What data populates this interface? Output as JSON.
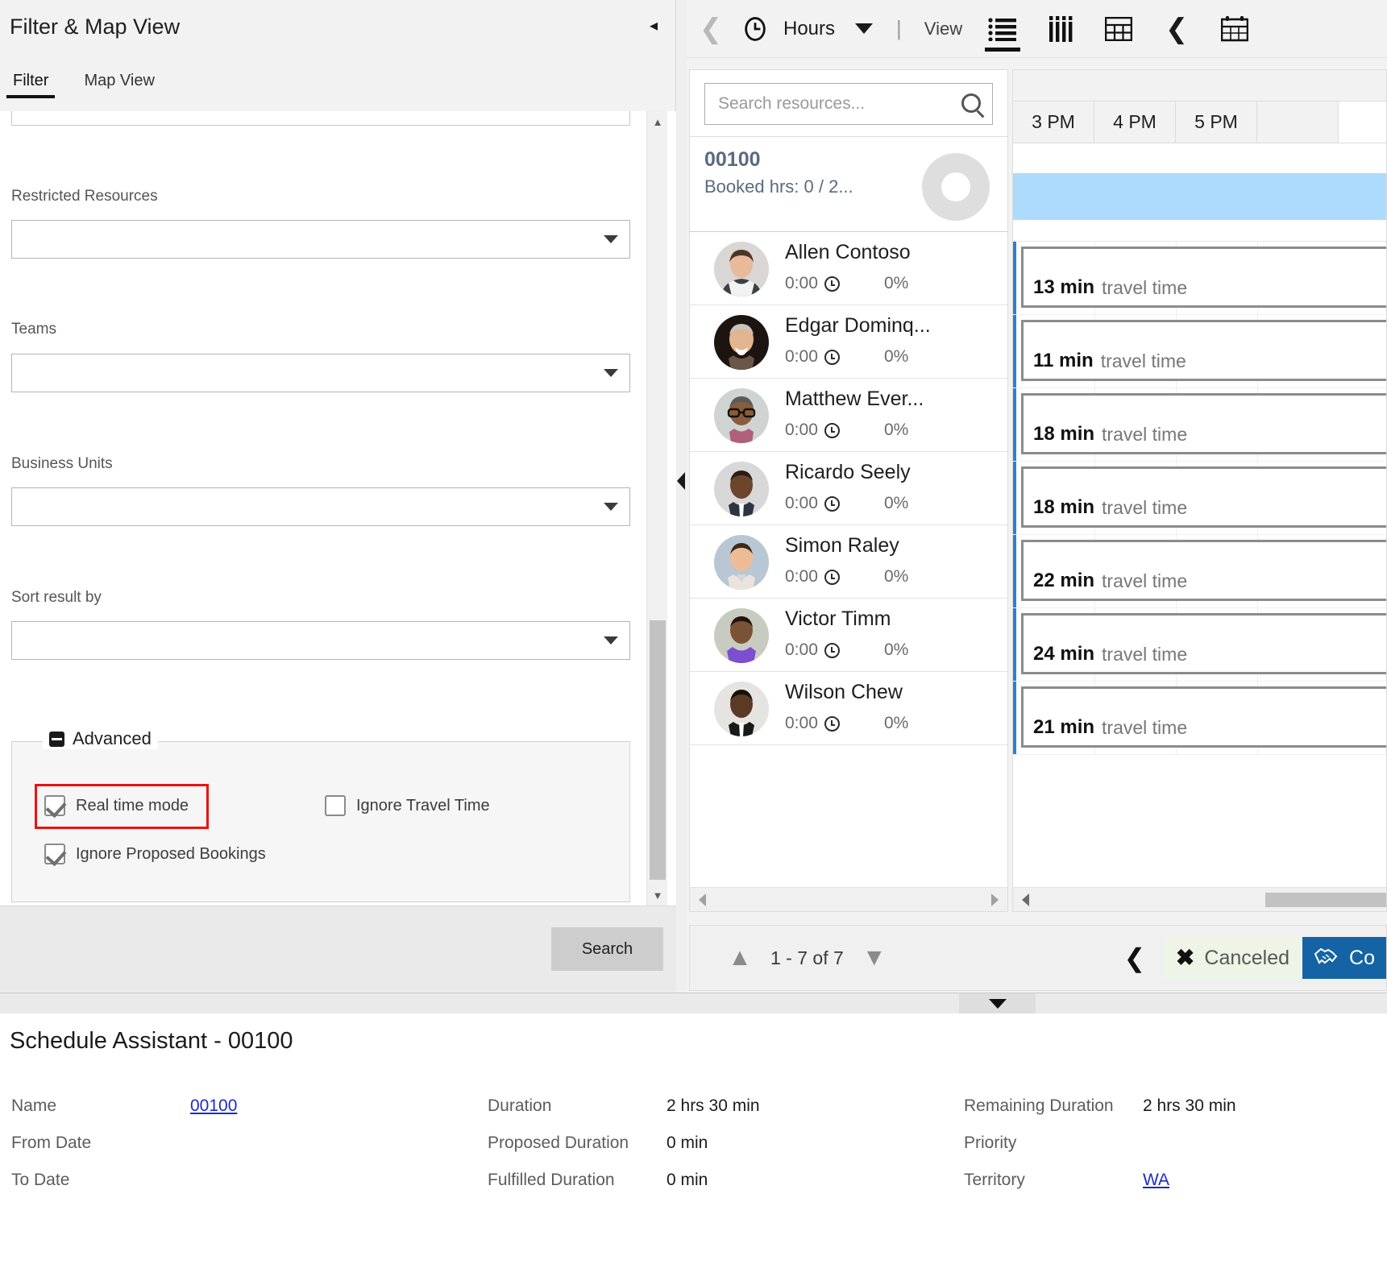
{
  "filter_panel": {
    "title": "Filter & Map View",
    "collapse_icon": "chevron-left-icon",
    "tabs": [
      {
        "label": "Filter",
        "active": true
      },
      {
        "label": "Map View",
        "active": false
      }
    ],
    "fields": [
      {
        "label": "Restricted Resources",
        "value": ""
      },
      {
        "label": "Teams",
        "value": ""
      },
      {
        "label": "Business Units",
        "value": ""
      },
      {
        "label": "Sort result by",
        "value": ""
      }
    ],
    "advanced": {
      "legend": "Advanced",
      "checkboxes": [
        {
          "label": "Real time mode",
          "checked": true,
          "highlighted": true
        },
        {
          "label": "Ignore Travel Time",
          "checked": false,
          "highlighted": false
        },
        {
          "label": "Ignore Proposed Bookings",
          "checked": true,
          "highlighted": false
        }
      ]
    },
    "footer": {
      "search_label": "Search"
    },
    "highlight_color": "#ee1111"
  },
  "schedule": {
    "toolbar": {
      "prev_label": "chevron-left-icon",
      "clock_icon": "clock-icon",
      "unit_label": "Hours",
      "unit_caret": "caret-down-icon",
      "separator": "|",
      "view_label": "View",
      "icons": [
        {
          "name": "list-view-icon",
          "active": true
        },
        {
          "name": "column-view-icon",
          "active": false
        },
        {
          "name": "grid-view-icon",
          "active": false
        },
        {
          "name": "collapse-chevron-icon",
          "active": false
        },
        {
          "name": "calendar-icon",
          "active": false
        }
      ]
    },
    "search": {
      "placeholder": "Search resources...",
      "value": "",
      "icon": "search-icon"
    },
    "requirement": {
      "id": "00100",
      "booked": "Booked hrs: 0 / 2...",
      "progress_icon": "donut-progress-icon"
    },
    "resources": [
      {
        "name": "Allen Contoso",
        "hours": "0:00",
        "percent": "0%"
      },
      {
        "name": "Edgar Dominq...",
        "hours": "0:00",
        "percent": "0%"
      },
      {
        "name": "Matthew Ever...",
        "hours": "0:00",
        "percent": "0%"
      },
      {
        "name": "Ricardo Seely",
        "hours": "0:00",
        "percent": "0%"
      },
      {
        "name": "Simon Raley",
        "hours": "0:00",
        "percent": "0%"
      },
      {
        "name": "Victor Timm",
        "hours": "0:00",
        "percent": "0%"
      },
      {
        "name": "Wilson Chew",
        "hours": "0:00",
        "percent": "0%"
      }
    ],
    "timeline": {
      "hours": [
        "3 PM",
        "4 PM",
        "5 PM"
      ],
      "highlight_color": "#addbfd",
      "travel_suffix": "travel time",
      "blocks": [
        {
          "minutes": "13 min"
        },
        {
          "minutes": "11 min"
        },
        {
          "minutes": "18 min"
        },
        {
          "minutes": "18 min"
        },
        {
          "minutes": "22 min"
        },
        {
          "minutes": "24 min"
        },
        {
          "minutes": "21 min"
        }
      ]
    },
    "footer": {
      "page_up_icon": "chevron-up-icon",
      "page_text": "1 - 7 of 7",
      "page_down_icon": "chevron-down-icon",
      "back_icon": "chevron-left-icon",
      "cancel_label": "Canceled",
      "cancel_icon": "close-x-icon",
      "cancel_bg": "#eef5e6",
      "commit_label": "Co",
      "commit_icon": "handshake-icon",
      "commit_bg": "#1464a5"
    }
  },
  "detail": {
    "title": "Schedule Assistant - 00100",
    "columns": [
      {
        "rows": [
          {
            "label": "Name",
            "value": "00100",
            "link": true
          },
          {
            "label": "From Date",
            "value": "",
            "link": false
          },
          {
            "label": "To Date",
            "value": "",
            "link": false
          }
        ]
      },
      {
        "rows": [
          {
            "label": "Duration",
            "value": "2 hrs 30 min",
            "link": false
          },
          {
            "label": "Proposed Duration",
            "value": "0 min",
            "link": false
          },
          {
            "label": "Fulfilled Duration",
            "value": "0 min",
            "link": false
          }
        ]
      },
      {
        "rows": [
          {
            "label": "Remaining Duration",
            "value": "2 hrs 30 min",
            "link": false
          },
          {
            "label": "Priority",
            "value": "",
            "link": false
          },
          {
            "label": "Territory",
            "value": "WA",
            "link": true
          }
        ]
      }
    ]
  }
}
